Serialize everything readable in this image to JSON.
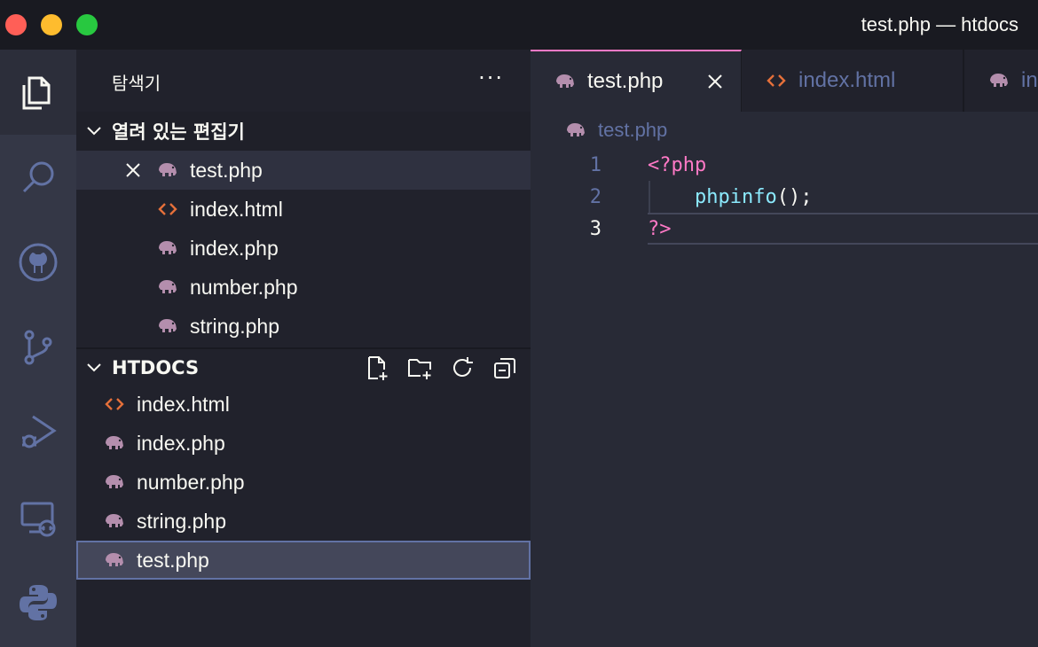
{
  "window": {
    "title": "test.php — htdocs"
  },
  "activity_bar": {
    "items": [
      {
        "icon": "explorer-icon",
        "active": true
      },
      {
        "icon": "search-icon"
      },
      {
        "icon": "github-icon"
      },
      {
        "icon": "source-control-icon"
      },
      {
        "icon": "run-debug-icon"
      },
      {
        "icon": "remote-explorer-icon"
      },
      {
        "icon": "python-icon"
      }
    ]
  },
  "sidebar": {
    "title": "탐색기",
    "more": "···",
    "open_editors": {
      "title": "열려 있는 편집기",
      "items": [
        {
          "name": "test.php",
          "type": "php"
        },
        {
          "name": "index.html",
          "type": "html"
        },
        {
          "name": "index.php",
          "type": "php"
        },
        {
          "name": "number.php",
          "type": "php"
        },
        {
          "name": "string.php",
          "type": "php"
        }
      ]
    },
    "folder": {
      "title": "HTDOCS",
      "items": [
        {
          "name": "index.html",
          "type": "html"
        },
        {
          "name": "index.php",
          "type": "php"
        },
        {
          "name": "number.php",
          "type": "php"
        },
        {
          "name": "string.php",
          "type": "php"
        },
        {
          "name": "test.php",
          "type": "php"
        }
      ]
    }
  },
  "editor": {
    "tabs": [
      {
        "label": "test.php",
        "type": "php",
        "active": true
      },
      {
        "label": "index.html",
        "type": "html"
      },
      {
        "label": "in",
        "type": "php"
      }
    ],
    "breadcrumb": "test.php",
    "lines": [
      {
        "num": "1",
        "parts": [
          {
            "t": "<?php",
            "c": "pink"
          }
        ]
      },
      {
        "num": "2",
        "parts": [
          {
            "t": "    ",
            "c": "fg"
          },
          {
            "t": "phpinfo",
            "c": "cyan"
          },
          {
            "t": "();",
            "c": "fg"
          }
        ]
      },
      {
        "num": "3",
        "parts": [
          {
            "t": "?>",
            "c": "pink"
          }
        ]
      }
    ]
  },
  "colors": {
    "php_icon": "#b48ead",
    "html_icon": "#e5703a",
    "accent": "#ff79c6"
  }
}
